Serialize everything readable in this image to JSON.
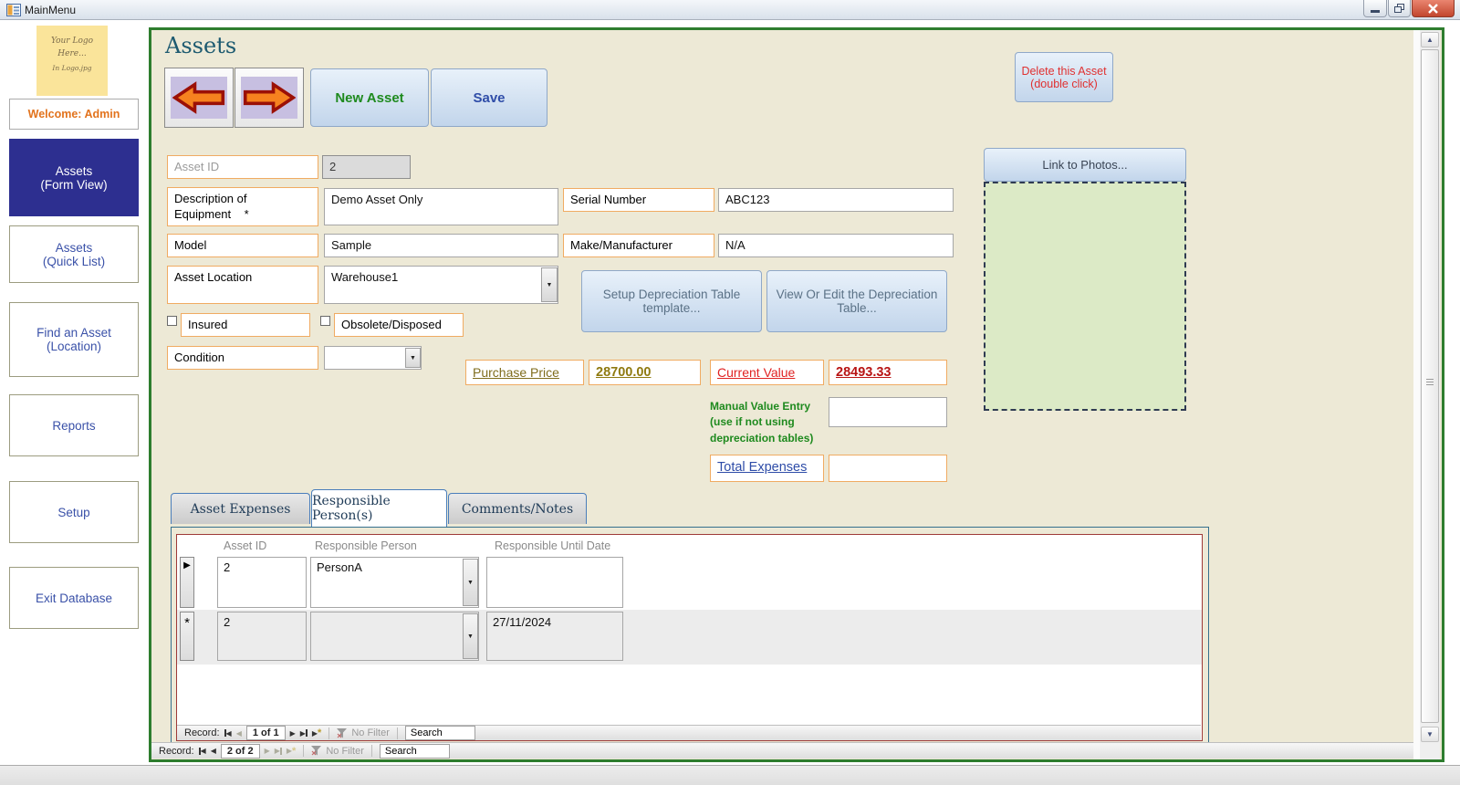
{
  "colors": {
    "form_border_green": "#2E7D2E",
    "form_background": "#EDE9D6",
    "label_border_orange": "#F0AB62",
    "active_nav_blue": "#2D2F90",
    "sidebar_text_blue": "#3A51A8",
    "welcome_orange": "#E2731D",
    "new_asset_green": "#1E8A1E",
    "save_blue": "#2F4DA8",
    "delete_red": "#E03030",
    "purchase_olive": "#8F7A10",
    "current_value_red": "#C01818",
    "manual_entry_green": "#1E8A1E",
    "subform_border_maroon": "#9E3A38",
    "photo_area_green": "#DCEAC6",
    "arrow_orange": "#F6821F"
  },
  "window": {
    "title": "MainMenu"
  },
  "sidebar": {
    "logo": {
      "line1": "Your Logo",
      "line2": "Here...",
      "line3": "In Logo.jpg"
    },
    "welcome": "Welcome: Admin",
    "items": [
      {
        "label": "Assets\n(Form View)",
        "active": true
      },
      {
        "label": "Assets\n(Quick List)",
        "active": false
      },
      {
        "label": "Find an Asset\n(Location)",
        "active": false
      },
      {
        "label": "Reports",
        "active": false
      },
      {
        "label": "Setup",
        "active": false
      },
      {
        "label": "Exit Database",
        "active": false
      }
    ]
  },
  "form": {
    "title": "Assets",
    "toolbar": {
      "new_asset": "New Asset",
      "save": "Save",
      "delete": "Delete this Asset (double click)"
    },
    "fields": {
      "asset_id": {
        "label": "Asset ID",
        "value": "2"
      },
      "description": {
        "label": "Description of\nEquipment    *",
        "value": "Demo Asset Only"
      },
      "serial": {
        "label": "Serial Number",
        "value": "ABC123"
      },
      "model": {
        "label": "Model",
        "value": "Sample"
      },
      "make": {
        "label": "Make/Manufacturer",
        "value": "N/A"
      },
      "location": {
        "label": "Asset Location",
        "value": "Warehouse1"
      },
      "insured": {
        "label": "Insured",
        "checked": false
      },
      "obsolete": {
        "label": "Obsolete/Disposed",
        "checked": false
      },
      "condition": {
        "label": "Condition",
        "value": ""
      }
    },
    "depreciation": {
      "setup": "Setup Depreciation Table template...",
      "view": "View Or Edit the Depreciation Table..."
    },
    "pricing": {
      "purchase_label": "Purchase Price",
      "purchase_value": "28700.00",
      "current_label": "Current Value",
      "current_value": "28493.33",
      "manual_note": "Manual Value Entry (use if not using depreciation tables)",
      "total_label": "Total Expenses",
      "total_value": ""
    },
    "photos": {
      "link_button": "Link to Photos..."
    },
    "tabs": [
      {
        "label": "Asset Expenses",
        "active": false
      },
      {
        "label": "Responsible Person(s)",
        "active": true
      },
      {
        "label": "Comments/Notes",
        "active": false
      }
    ],
    "subform": {
      "columns": [
        "Asset ID",
        "Responsible Person",
        "Responsible Until Date"
      ],
      "rows": [
        {
          "asset_id": "2",
          "person": "PersonA",
          "until": ""
        },
        {
          "asset_id": "2",
          "person": "",
          "until": "27/11/2024"
        }
      ],
      "nav": {
        "label": "Record:",
        "position": "1 of 1",
        "filter": "No Filter",
        "search": "Search"
      }
    },
    "record_nav": {
      "label": "Record:",
      "position": "2 of 2",
      "filter": "No Filter",
      "search": "Search"
    }
  }
}
